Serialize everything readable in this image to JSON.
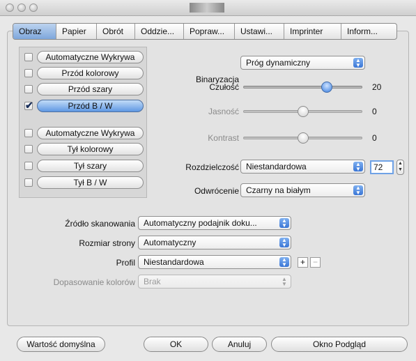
{
  "tabs": [
    "Obraz",
    "Papier",
    "Obrót",
    "Oddzie...",
    "Popraw...",
    "Ustawi...",
    "Imprinter",
    "Inform..."
  ],
  "sources": [
    {
      "label": "Automatyczne Wykrywa",
      "checked": false,
      "selected": false
    },
    {
      "label": "Przód kolorowy",
      "checked": false,
      "selected": false
    },
    {
      "label": "Przód szary",
      "checked": false,
      "selected": false
    },
    {
      "label": "Przód B / W",
      "checked": true,
      "selected": true
    },
    {
      "label": "Automatyczne Wykrywa",
      "checked": false,
      "selected": false
    },
    {
      "label": "Tył kolorowy",
      "checked": false,
      "selected": false
    },
    {
      "label": "Tył szary",
      "checked": false,
      "selected": false
    },
    {
      "label": "Tył B / W",
      "checked": false,
      "selected": false
    }
  ],
  "checkmark": "✔",
  "binarization": {
    "label": "Binaryzacja",
    "value": "Próg dynamiczny"
  },
  "sensitivity": {
    "label": "Czułość",
    "value": "20",
    "level": 0.72
  },
  "brightness": {
    "label": "Jasność",
    "value": "0",
    "level": 0.5
  },
  "contrast": {
    "label": "Kontrast",
    "value": "0",
    "level": 0.5
  },
  "resolution": {
    "label": "Rozdzielczość",
    "value": "Niestandardowa",
    "number": "72"
  },
  "inversion": {
    "label": "Odwrócenie",
    "value": "Czarny na białym"
  },
  "scan_source": {
    "label": "Źródło skanowania",
    "value": "Automatyczny podajnik doku..."
  },
  "page_size": {
    "label": "Rozmiar strony",
    "value": "Automatyczny"
  },
  "profile": {
    "label": "Profil",
    "value": "Niestandardowa",
    "add": "+",
    "remove": "−"
  },
  "color_matching": {
    "label": "Dopasowanie kolorów",
    "value": "Brak"
  },
  "buttons": {
    "default": "Wartość domyślna",
    "ok": "OK",
    "cancel": "Anuluj",
    "preview": "Okno Podgląd"
  },
  "accent": "#5f98e3"
}
